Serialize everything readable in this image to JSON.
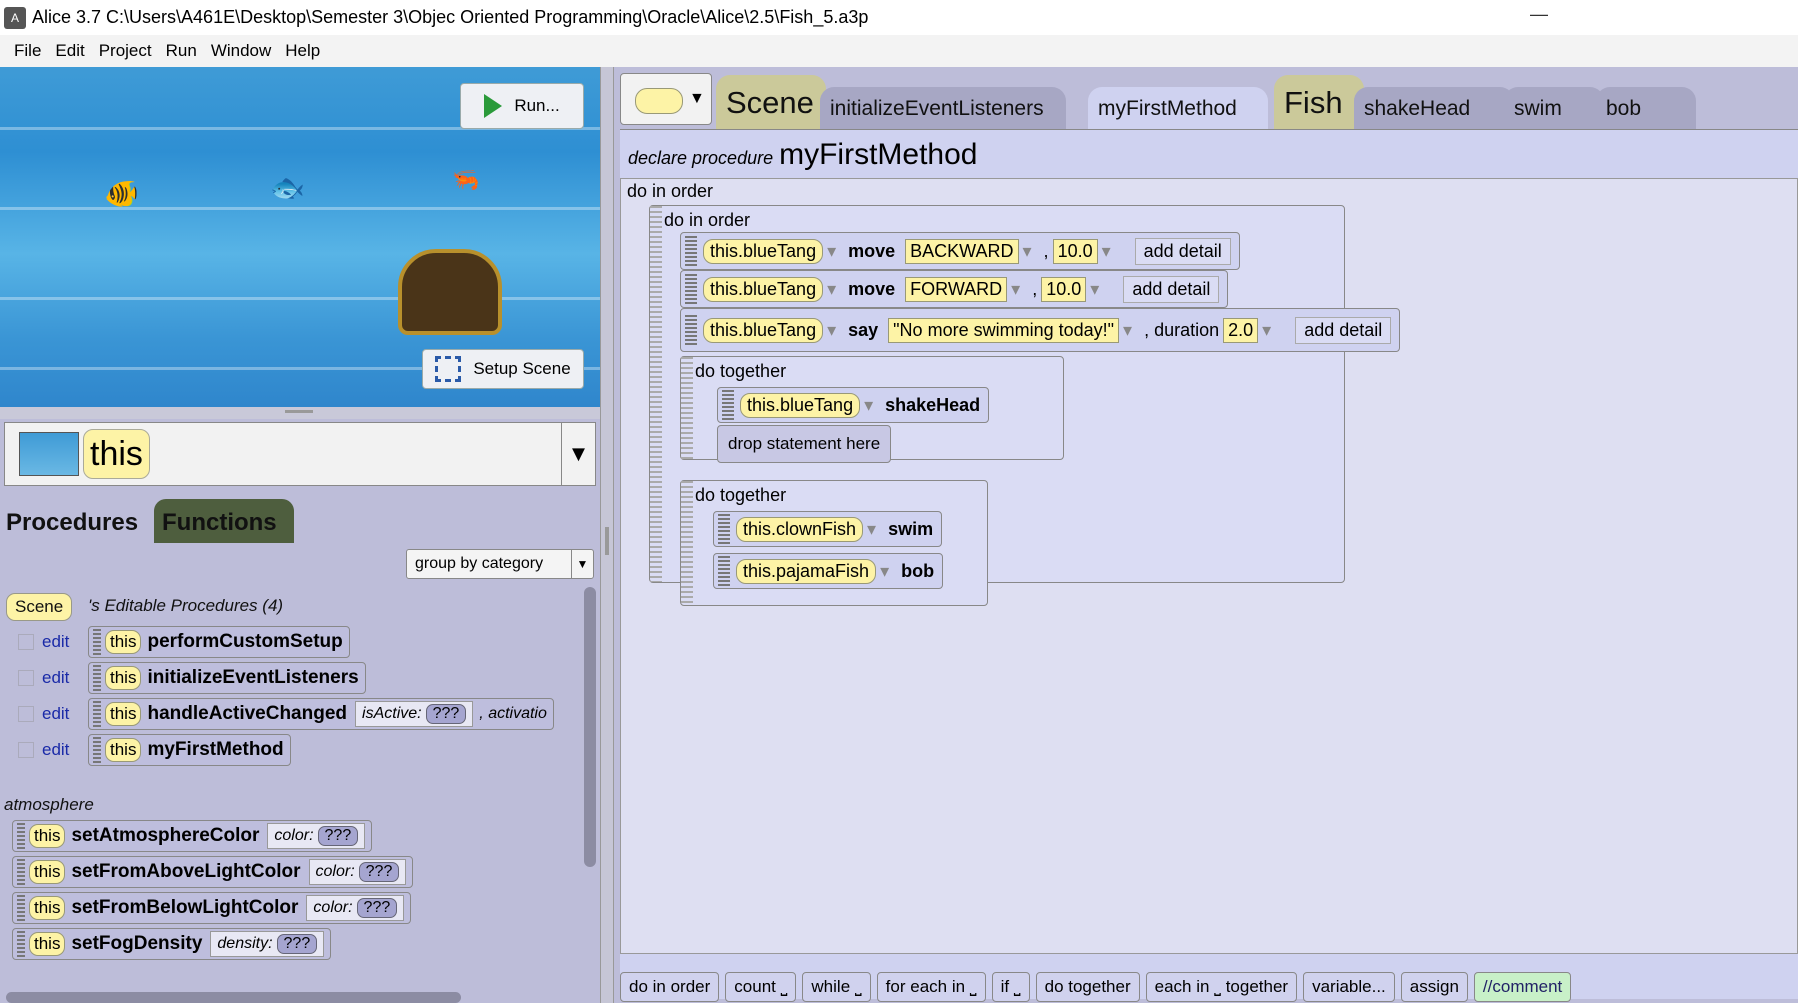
{
  "window": {
    "title": "Alice 3.7 C:\\Users\\A461E\\Desktop\\Semester 3\\Objec Oriented Programming\\Oracle\\Alice\\2.5\\Fish_5.a3p"
  },
  "menu": [
    "File",
    "Edit",
    "Project",
    "Run",
    "Window",
    "Help"
  ],
  "scene_view": {
    "run_label": "Run...",
    "setup_label": "Setup Scene"
  },
  "selector": {
    "label": "this"
  },
  "palette": {
    "tabs": {
      "procedures": "Procedures",
      "functions": "Functions"
    },
    "group_select": "group by category",
    "scene_pill": "Scene",
    "editable_header": "'s Editable Procedures (4)",
    "edit_label": "edit",
    "this_label": "this",
    "editable": [
      {
        "name": "performCustomSetup"
      },
      {
        "name": "initializeEventListeners"
      },
      {
        "name": "handleActiveChanged",
        "param1": "isActive:",
        "param1_val": "???",
        "param2": ", activatio"
      },
      {
        "name": "myFirstMethod"
      }
    ],
    "atmosphere_header": "atmosphere",
    "atmosphere": [
      {
        "name": "setAtmosphereColor",
        "param": "color:",
        "val": "???"
      },
      {
        "name": "setFromAboveLightColor",
        "param": "color:",
        "val": "???"
      },
      {
        "name": "setFromBelowLightColor",
        "param": "color:",
        "val": "???"
      },
      {
        "name": "setFogDensity",
        "param": "density:",
        "val": "???"
      }
    ]
  },
  "editor_tabs": {
    "scene": "Scene",
    "init": "initializeEventListeners",
    "myfirst": "myFirstMethod",
    "fish": "Fish",
    "shake": "shakeHead",
    "swim": "swim",
    "bob": "bob"
  },
  "method": {
    "declare": "declare procedure",
    "name": "myFirstMethod",
    "do_in_order": "do in order",
    "inner_do_in_order": "do in order",
    "statements": [
      {
        "obj": "this.blueTang",
        "verb": "move",
        "arg": "BACKWARD",
        "amount": "10.0",
        "add": "add detail"
      },
      {
        "obj": "this.blueTang",
        "verb": "move",
        "arg": "FORWARD",
        "amount": "10.0",
        "add": "add detail"
      },
      {
        "obj": "this.blueTang",
        "verb": "say",
        "arg": "\"No more swimming today!\"",
        "dur_label": ", duration",
        "amount": "2.0",
        "add": "add detail"
      }
    ],
    "together1": {
      "label": "do together",
      "obj": "this.blueTang",
      "verb": "shakeHead",
      "drop": "drop statement here"
    },
    "together2": {
      "label": "do together",
      "s1": {
        "obj": "this.clownFish",
        "verb": "swim"
      },
      "s2": {
        "obj": "this.pajamaFish",
        "verb": "bob"
      }
    }
  },
  "bottom_bar": [
    "do in order",
    "count ⎵",
    "while ⎵",
    "for each in ⎵",
    "if ⎵",
    "do together",
    "each in ⎵ together",
    "variable...",
    "assign",
    "//comment"
  ]
}
